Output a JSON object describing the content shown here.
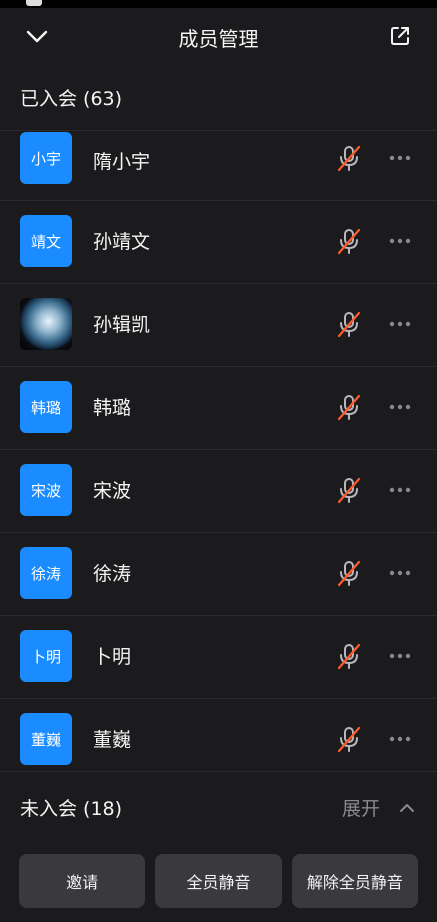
{
  "header": {
    "title": "成员管理"
  },
  "joined": {
    "label": "已入会 (63)",
    "members": [
      {
        "name": "隋小宇",
        "avatar_text": "小宇",
        "avatar_type": "text",
        "muted": true
      },
      {
        "name": "孙靖文",
        "avatar_text": "靖文",
        "avatar_type": "text",
        "muted": true
      },
      {
        "name": "孙辑凯",
        "avatar_text": "",
        "avatar_type": "photo",
        "muted": true
      },
      {
        "name": "韩璐",
        "avatar_text": "韩璐",
        "avatar_type": "text",
        "muted": true
      },
      {
        "name": "宋波",
        "avatar_text": "宋波",
        "avatar_type": "text",
        "muted": true
      },
      {
        "name": "徐涛",
        "avatar_text": "徐涛",
        "avatar_type": "text",
        "muted": true
      },
      {
        "name": "卜明",
        "avatar_text": "卜明",
        "avatar_type": "text",
        "muted": true
      },
      {
        "name": "董巍",
        "avatar_text": "董巍",
        "avatar_type": "text",
        "muted": true
      }
    ]
  },
  "not_joined": {
    "label": "未入会 (18)",
    "expand_label": "展开"
  },
  "actions": {
    "invite": "邀请",
    "mute_all": "全员静音",
    "unmute_all": "解除全员静音"
  },
  "colors": {
    "accent": "#1a8cff",
    "muted_slash": "#ff5a2a",
    "background": "#1b1b1d"
  },
  "icons": {
    "back": "chevron-down-icon",
    "share": "share-icon",
    "mic": "mic-muted-icon",
    "more": "more-icon",
    "collapse": "chevron-up-icon"
  }
}
